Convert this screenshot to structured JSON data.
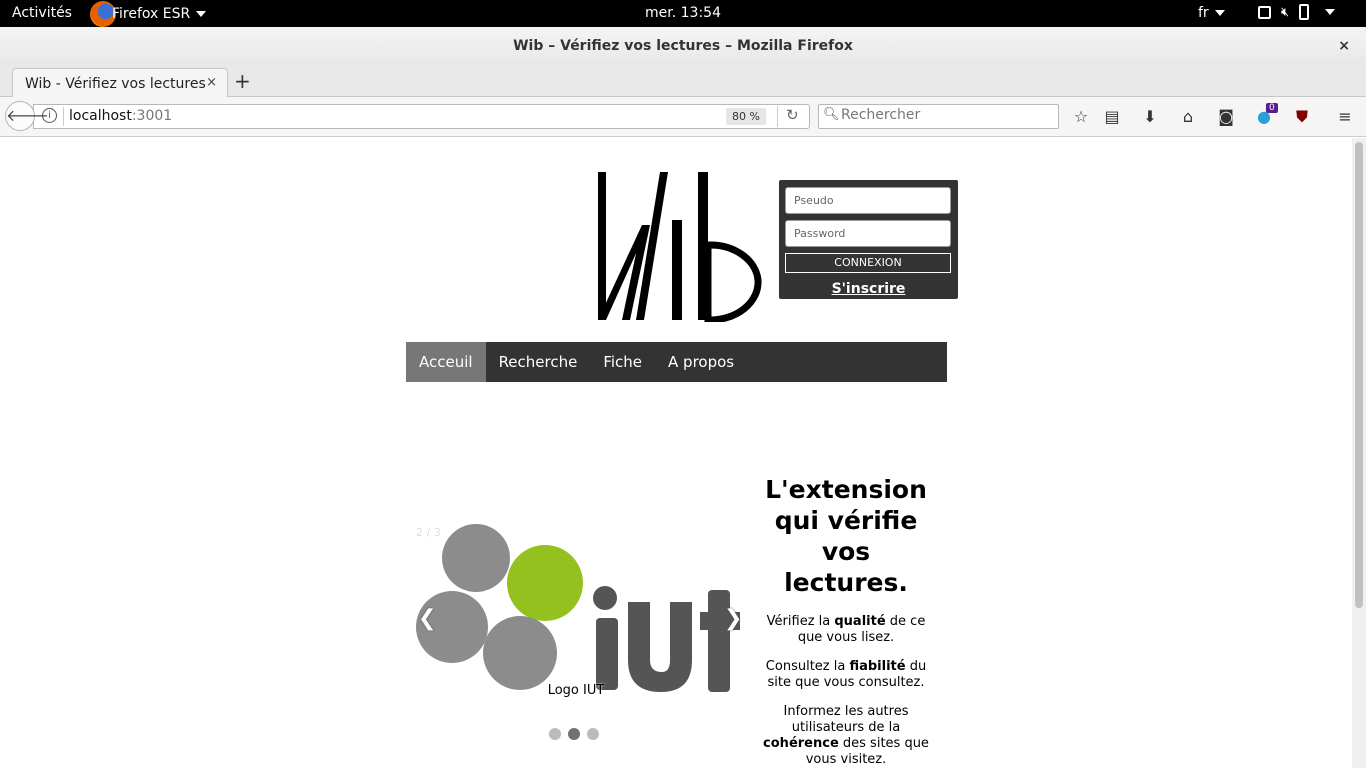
{
  "system": {
    "activities": "Activités",
    "app_name": "Firefox ESR",
    "clock": "mer. 13:54",
    "lang": "fr"
  },
  "window": {
    "title": "Wib – Vérifiez vos lectures – Mozilla Firefox",
    "close": "×"
  },
  "tab": {
    "label": "Wib - Vérifiez vos lectures",
    "close": "×",
    "new": "+"
  },
  "navbar": {
    "url_host": "localhost",
    "url_port": ":3001",
    "zoom": "80 %",
    "search_placeholder": "Rechercher",
    "addon_badge": "0"
  },
  "login": {
    "pseudo_placeholder": "Pseudo",
    "password_placeholder": "Password",
    "connexion": "CONNEXION",
    "signup": "S'inscrire"
  },
  "menu": {
    "items": [
      "Acceuil",
      "Recherche",
      "Fiche",
      "A propos"
    ]
  },
  "slider": {
    "counter": "2 / 3",
    "caption": "Logo IUT",
    "prev": "❮",
    "next": "❯",
    "active_dot": 2
  },
  "intro": {
    "tagline": "L'extension qui vérifie vos lectures.",
    "p1_a": "Vérifiez la ",
    "p1_b": "qualité",
    "p1_c": " de ce que vous lisez.",
    "p2_a": "Consultez la ",
    "p2_b": "fiabilité",
    "p2_c": " du site que vous consultez.",
    "p3_a": "Informez les autres utilisateurs de la ",
    "p3_b": "cohérence",
    "p3_c": " des sites que vous visitez."
  },
  "colors": {
    "menu_bg": "#333333",
    "menu_active": "#777777",
    "iut_green": "#95c11f",
    "iut_gray": "#8c8c8c",
    "iut_dark": "#555555"
  }
}
